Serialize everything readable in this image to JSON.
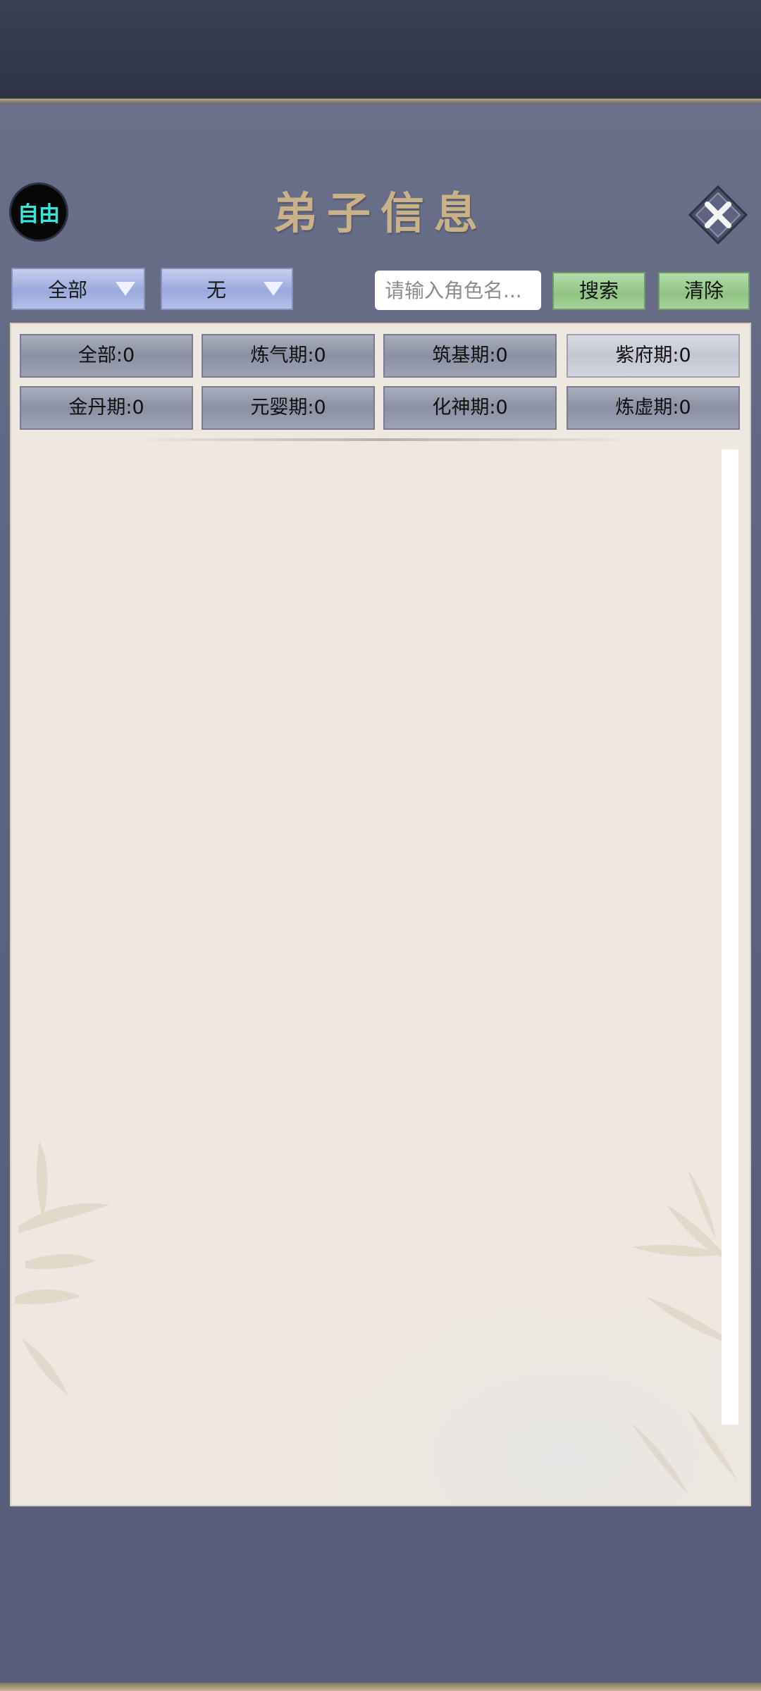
{
  "header": {
    "mode_badge": "自由",
    "title": "弟子信息",
    "close_icon": "close-x-icon"
  },
  "filters": {
    "dropdown_1": "全部",
    "dropdown_2": "无",
    "search_placeholder": "请输入角色名...",
    "search_button": "搜索",
    "clear_button": "清除"
  },
  "stages": [
    {
      "label": "全部:0"
    },
    {
      "label": "炼气期:0"
    },
    {
      "label": "筑基期:0"
    },
    {
      "label": "紫府期:0"
    },
    {
      "label": "金丹期:0"
    },
    {
      "label": "元婴期:0"
    },
    {
      "label": "化神期:0"
    },
    {
      "label": "炼虚期:0"
    }
  ],
  "colors": {
    "badge_text": "#38e6d9",
    "title": "#c9b287",
    "panel": "#efe8e0",
    "dropdown": "#9aa9dc",
    "action_button": "#8fc383"
  }
}
